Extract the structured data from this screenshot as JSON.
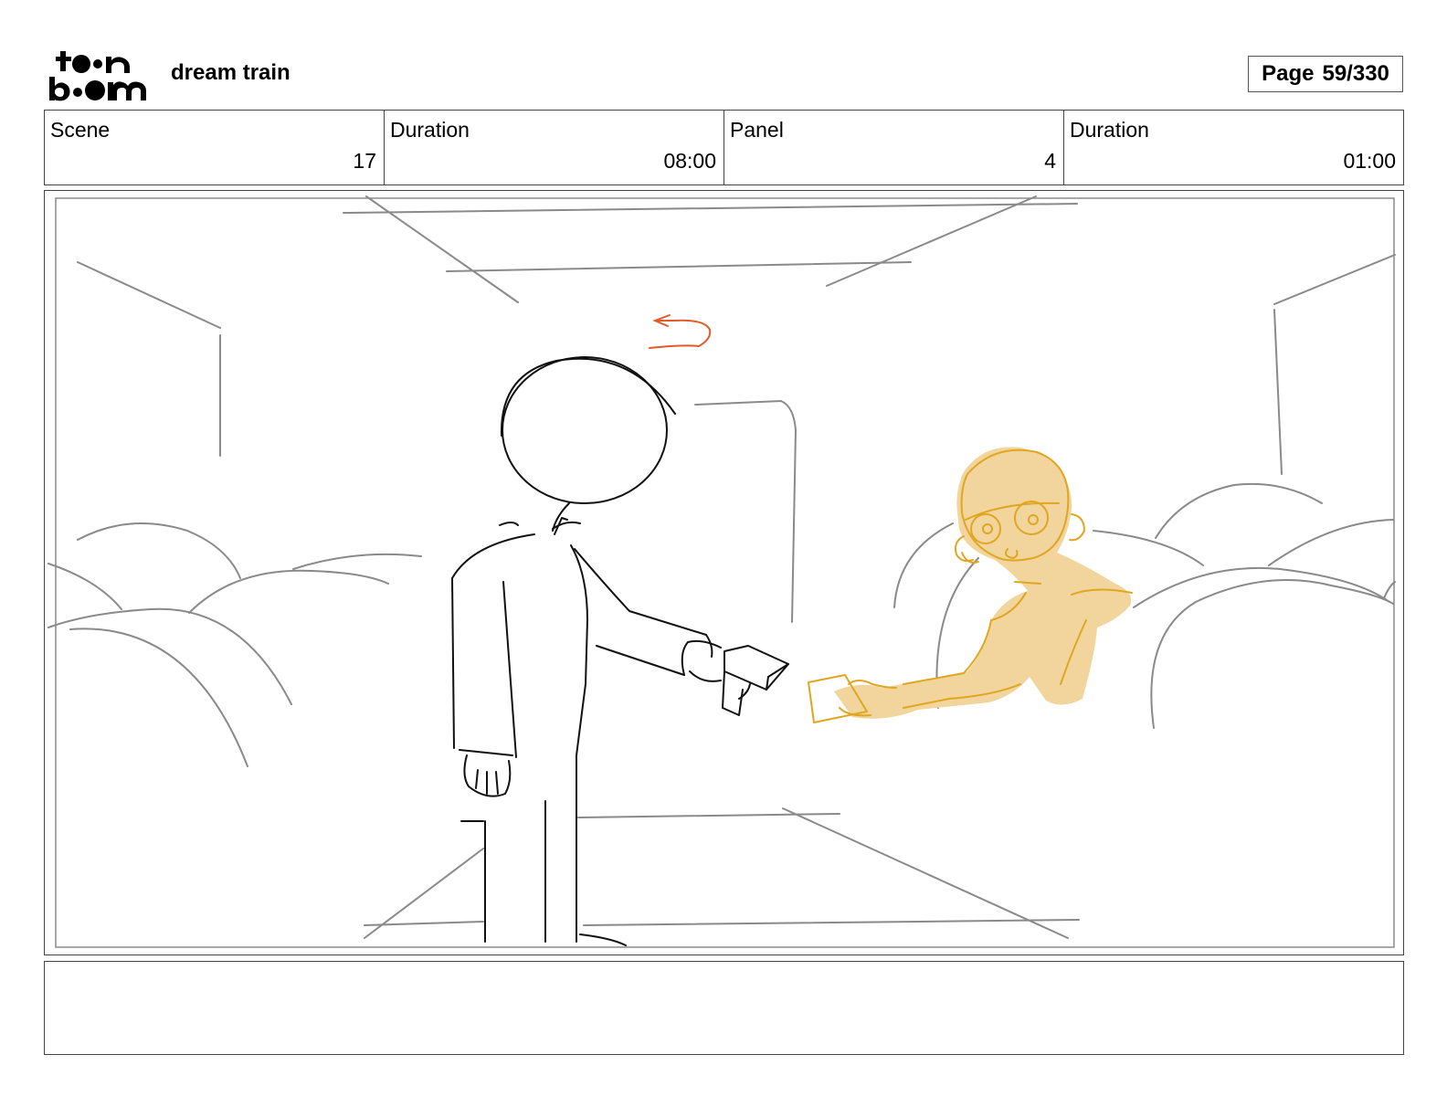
{
  "header": {
    "logo_text": "toon boom",
    "project_title": "dream train",
    "page_label": "Page",
    "page_number": "59/330"
  },
  "info": {
    "scene": {
      "label": "Scene",
      "value": "17"
    },
    "scene_duration": {
      "label": "Duration",
      "value": "08:00"
    },
    "panel": {
      "label": "Panel",
      "value": "4"
    },
    "panel_duration": {
      "label": "Duration",
      "value": "01:00"
    }
  },
  "caption": "",
  "colors": {
    "sketch_line": "#000000",
    "background_line": "#8a8a8a",
    "character_fill": "#f1d59c",
    "character_line": "#e0a621",
    "direction_arrow": "#e05a2b"
  }
}
